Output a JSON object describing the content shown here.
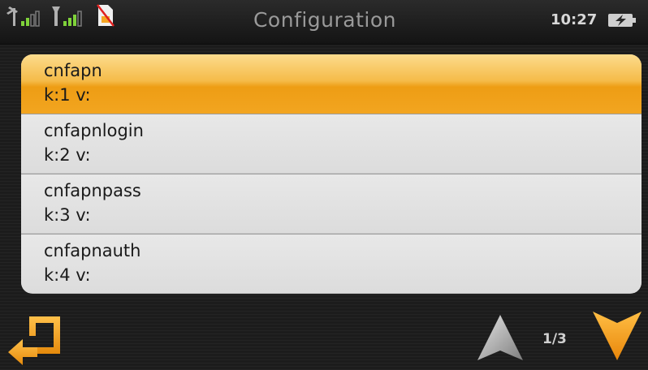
{
  "header": {
    "title": "Configuration",
    "time": "10:27"
  },
  "status_icons": [
    "gps-signal-icon",
    "gsm-signal-icon",
    "no-sim-icon",
    "battery-charging-icon"
  ],
  "list": {
    "items": [
      {
        "name": "cnfapn",
        "kv": "k:1 v:",
        "selected": true
      },
      {
        "name": "cnfapnlogin",
        "kv": "k:2 v:",
        "selected": false
      },
      {
        "name": "cnfapnpass",
        "kv": "k:3 v:",
        "selected": false
      },
      {
        "name": "cnfapnauth",
        "kv": "k:4 v:",
        "selected": false
      }
    ]
  },
  "footer": {
    "page_indicator": "1/3"
  },
  "colors": {
    "accent": "#f5a623",
    "selected_gradient_top": "#fcdc8d",
    "selected_gradient_bottom": "#ee9d14",
    "row_bg": "#e3e3e3",
    "header_text": "#9a9a9a"
  }
}
